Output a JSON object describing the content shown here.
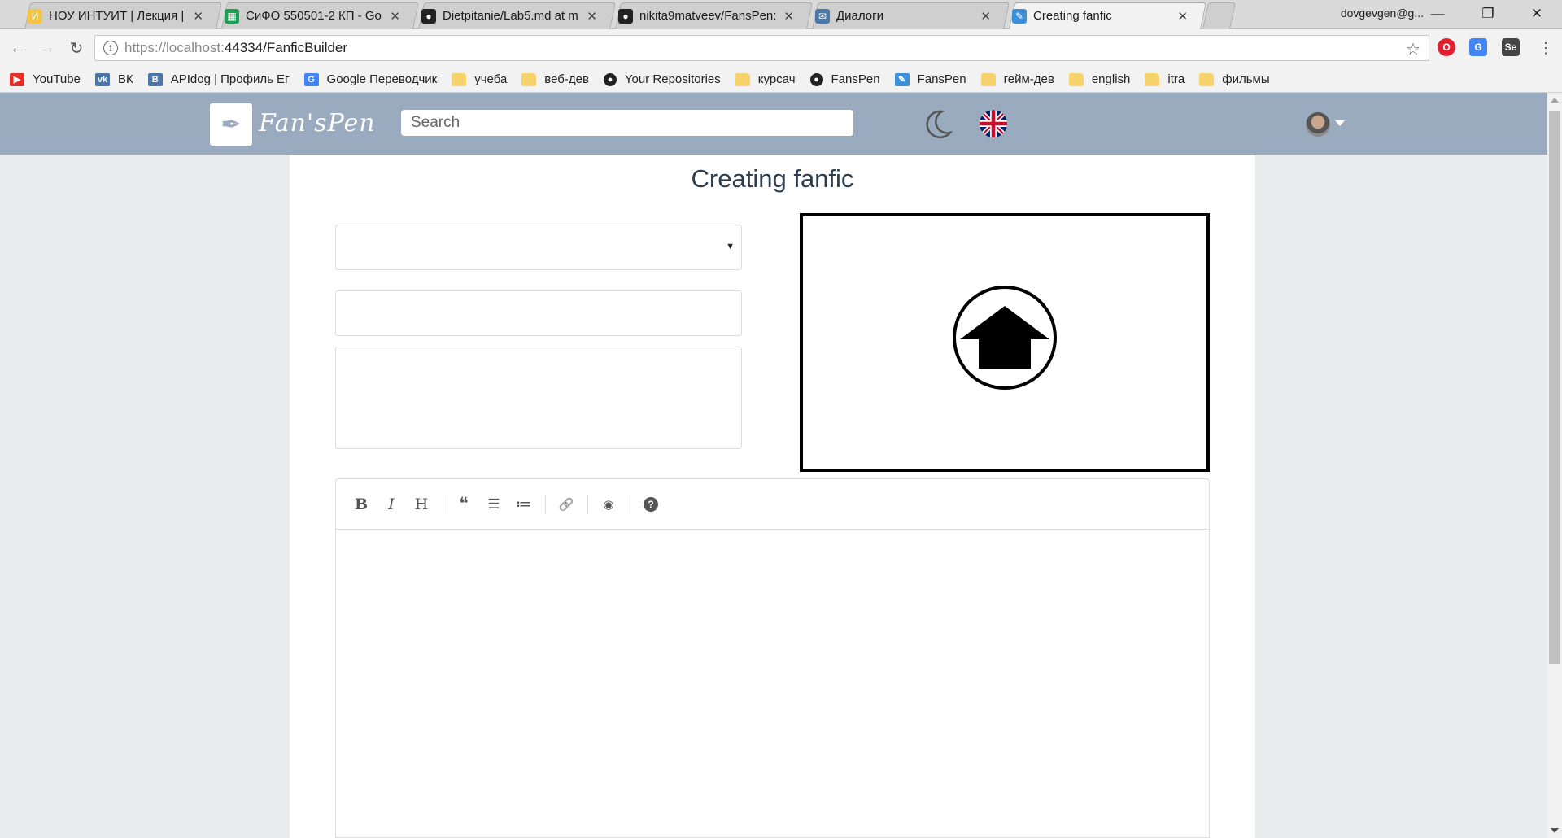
{
  "browser": {
    "tabs": [
      {
        "label": "НОУ ИНТУИТ | Лекция |",
        "favicon": "intuit-icon",
        "color": "#f4c542"
      },
      {
        "label": "СиФО 550501-2 КП - Go",
        "favicon": "sheets-icon",
        "color": "#1f9d55"
      },
      {
        "label": "Dietpitanie/Lab5.md at m",
        "favicon": "github-icon",
        "color": "#222222"
      },
      {
        "label": "nikita9matveev/FansPen:",
        "favicon": "github-icon",
        "color": "#222222"
      },
      {
        "label": "Диалоги",
        "favicon": "chat-icon",
        "color": "#4a76a8"
      },
      {
        "label": "Creating fanfic",
        "favicon": "fanspen-icon",
        "color": "#3d8fd8"
      }
    ],
    "close_glyph": "✕",
    "user": "dovgevgen@g...",
    "url_host": "https://localhost:",
    "url_rest": "44334/FanficBuilder",
    "bookmarks": [
      {
        "label": "YouTube",
        "icon": "youtube-icon",
        "color": "#e52d27"
      },
      {
        "label": "ВК",
        "icon": "vk-icon",
        "color": "#4a76a8"
      },
      {
        "label": "APIdog | Профиль Ег",
        "icon": "apidog-icon",
        "color": "#4a76a8"
      },
      {
        "label": "Google Переводчик",
        "icon": "translate-icon",
        "color": "#4285f4"
      },
      {
        "label": "учеба",
        "icon": "folder-icon",
        "color": "#f7d46b"
      },
      {
        "label": "веб-дев",
        "icon": "folder-icon",
        "color": "#f7d46b"
      },
      {
        "label": "Your Repositories",
        "icon": "github-icon",
        "color": "#222222"
      },
      {
        "label": "курсач",
        "icon": "folder-icon",
        "color": "#f7d46b"
      },
      {
        "label": "FansPen",
        "icon": "github-icon",
        "color": "#222222"
      },
      {
        "label": "FansPen",
        "icon": "fanspen-icon",
        "color": "#3d8fd8"
      },
      {
        "label": "гейм-дев",
        "icon": "folder-icon",
        "color": "#f7d46b"
      },
      {
        "label": "english",
        "icon": "folder-icon",
        "color": "#f7d46b"
      },
      {
        "label": "itra",
        "icon": "folder-icon",
        "color": "#f7d46b"
      },
      {
        "label": "фильмы",
        "icon": "folder-icon",
        "color": "#f7d46b"
      }
    ]
  },
  "app": {
    "brand": "Fan'sPen",
    "search_placeholder": "Search",
    "nav_bg": "#9aaabf",
    "page_title": "Creating fanfic",
    "select_value": "",
    "editor_toolbar": [
      "bold-icon",
      "italic-icon",
      "heading-icon",
      "|",
      "quote-icon",
      "unordered-list-icon",
      "ordered-list-icon",
      "|",
      "link-icon",
      "|",
      "preview-icon",
      "|",
      "help-icon"
    ]
  }
}
